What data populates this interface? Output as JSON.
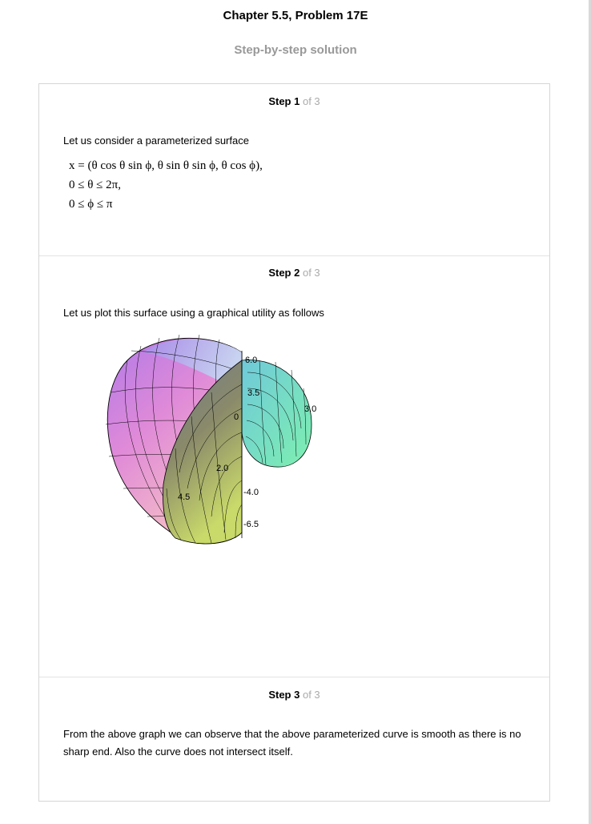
{
  "header": {
    "title": "Chapter 5.5, Problem 17E",
    "subtitle": "Step-by-step solution"
  },
  "steps": [
    {
      "label": "Step 1",
      "of_text": "of 3",
      "text": "Let us consider a parameterized surface",
      "math": [
        "x = (θ cos θ sin ϕ, θ sin θ sin ϕ, θ cos ϕ),",
        "0 ≤ θ ≤ 2π,",
        "0 ≤ ϕ ≤ π"
      ]
    },
    {
      "label": "Step 2",
      "of_text": "of 3",
      "text": "Let us plot this surface using a graphical utility as follows",
      "plot_labels": [
        "6.0",
        "3.5",
        "3.0",
        "0",
        "2.0",
        "4.5",
        "-4.0",
        "-6.5"
      ]
    },
    {
      "label": "Step 3",
      "of_text": "of 3",
      "text": "From the above graph we can observe that the above parameterized curve is smooth as there is no sharp end. Also the curve does not intersect itself."
    }
  ]
}
